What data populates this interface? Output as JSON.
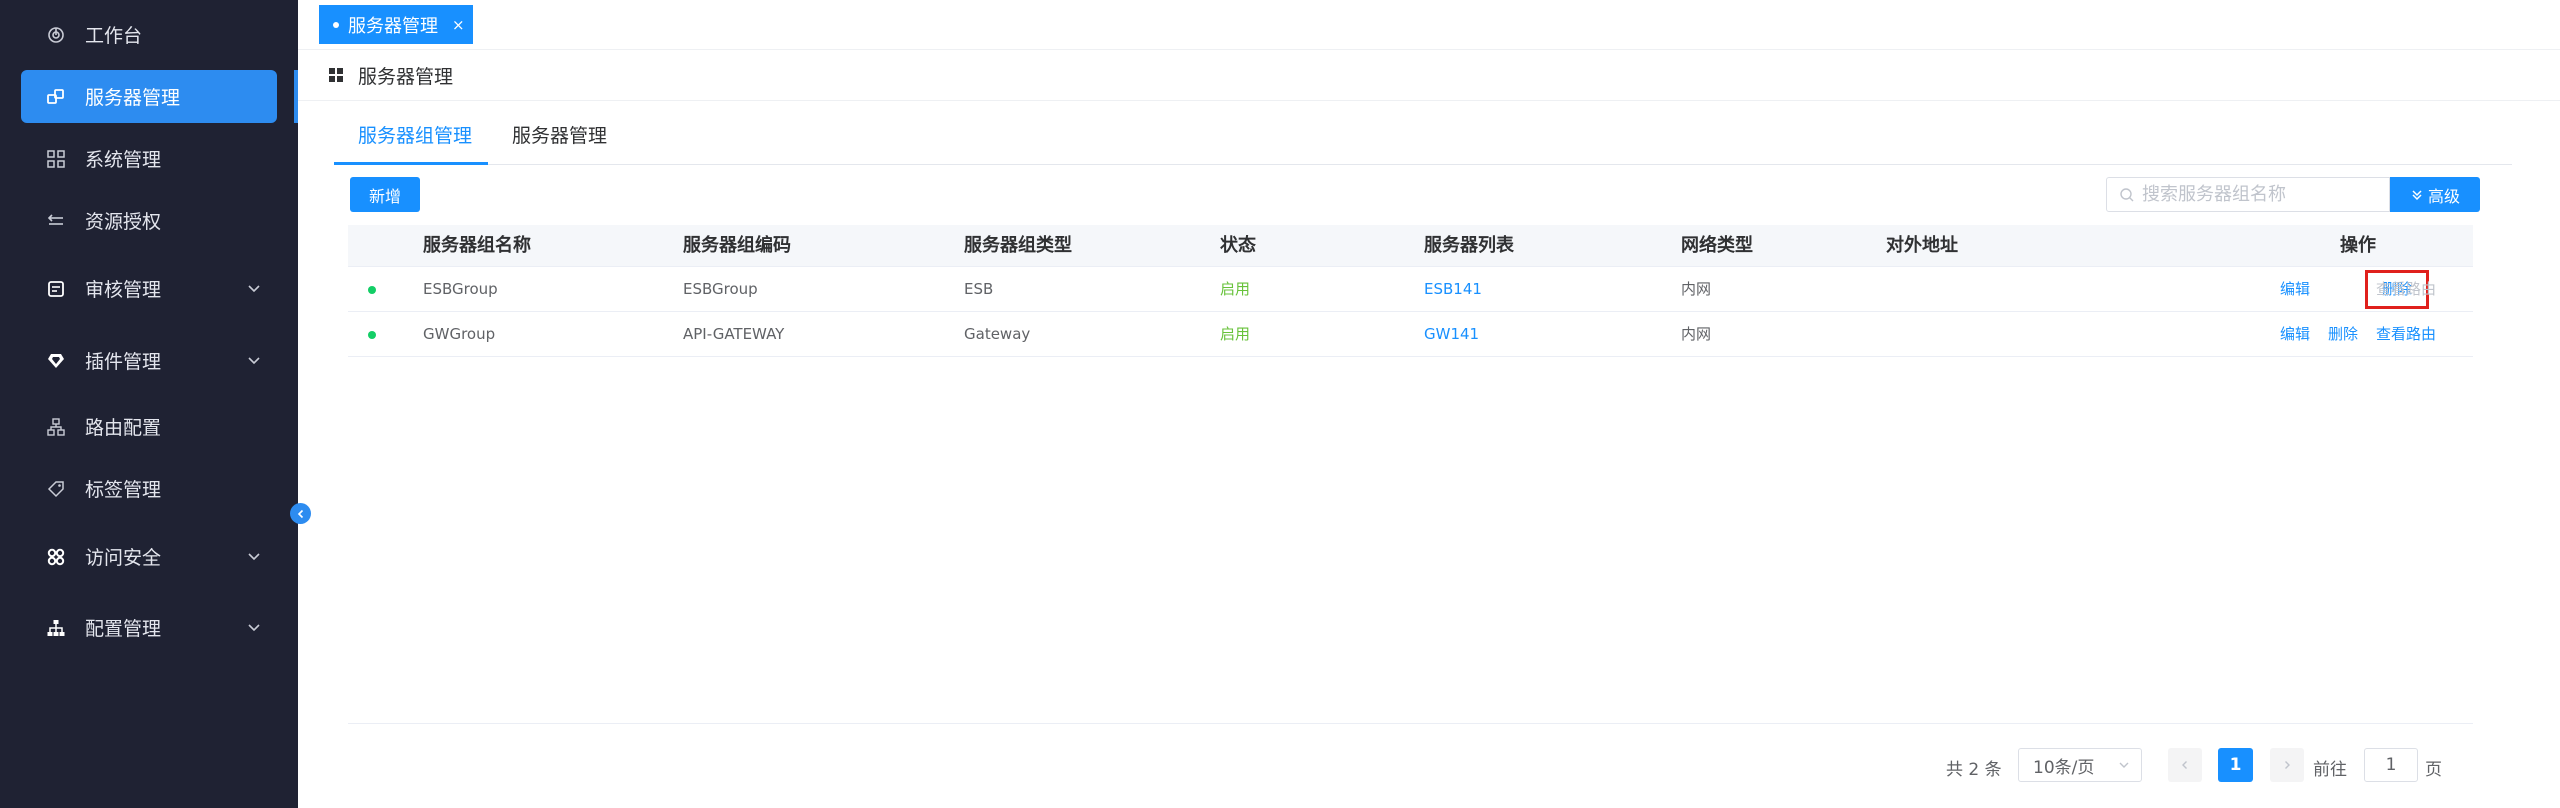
{
  "sidebar": {
    "items": [
      {
        "label": "工作台",
        "icon": "dashboard-icon"
      },
      {
        "label": "服务器管理",
        "icon": "server-link-icon",
        "active": true
      },
      {
        "label": "系统管理",
        "icon": "grid-icon"
      },
      {
        "label": "资源授权",
        "icon": "swap-icon"
      },
      {
        "label": "审核管理",
        "icon": "audit-icon",
        "expandable": true
      },
      {
        "label": "插件管理",
        "icon": "diamond-icon",
        "expandable": true
      },
      {
        "label": "路由配置",
        "icon": "route-icon"
      },
      {
        "label": "标签管理",
        "icon": "tag-icon"
      },
      {
        "label": "访问安全",
        "icon": "security-grid-icon",
        "expandable": true
      },
      {
        "label": "配置管理",
        "icon": "org-tree-icon",
        "expandable": true
      }
    ]
  },
  "tabs": {
    "open": [
      {
        "label": "服务器管理",
        "close": "×"
      }
    ]
  },
  "page": {
    "title": "服务器管理"
  },
  "subtabs": [
    {
      "label": "服务器组管理",
      "active": true
    },
    {
      "label": "服务器管理",
      "active": false
    }
  ],
  "toolbar": {
    "add_label": "新增",
    "search_placeholder": "搜索服务器组名称",
    "advanced_label": "高级"
  },
  "table": {
    "columns": [
      "服务器组名称",
      "服务器组编码",
      "服务器组类型",
      "状态",
      "服务器列表",
      "网络类型",
      "对外地址",
      "操作"
    ],
    "rows": [
      {
        "name": "ESBGroup",
        "code": "ESBGroup",
        "type": "ESB",
        "status": "启用",
        "servers": "ESB141",
        "network": "内网",
        "external": "",
        "ops": {
          "edit": "编辑",
          "delete": "删除",
          "view_route": "查看路由",
          "view_route_disabled": true
        }
      },
      {
        "name": "GWGroup",
        "code": "API-GATEWAY",
        "type": "Gateway",
        "status": "启用",
        "servers": "GW141",
        "network": "内网",
        "external": "",
        "ops": {
          "edit": "编辑",
          "delete": "删除",
          "view_route": "查看路由",
          "view_route_disabled": false
        }
      }
    ]
  },
  "pagination": {
    "total": "共 2 条",
    "page_size": "10条/页",
    "current_page": "1",
    "goto_label": "前往",
    "goto_value": "1",
    "goto_unit": "页"
  },
  "colors": {
    "sidebar_bg": "#1f2233",
    "accent": "#1890ff",
    "status_green": "#67c23a",
    "highlight_red": "#e0201c"
  }
}
